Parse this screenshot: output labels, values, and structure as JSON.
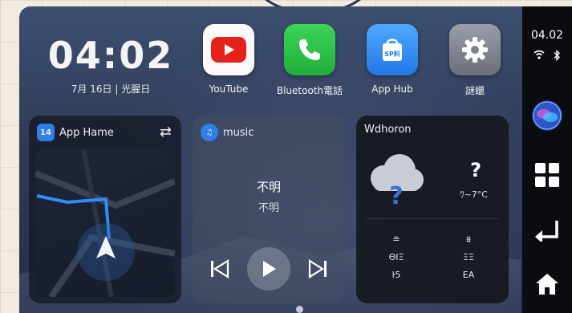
{
  "clock": {
    "time": "04:02",
    "date": "7月 16日 | 光腥日"
  },
  "apps": [
    {
      "label": "YouTube",
      "icon": "youtube-icon"
    },
    {
      "label": "Bluetooth電話",
      "icon": "phone-icon"
    },
    {
      "label": "App Hub",
      "icon": "shopping-bag-icon",
      "icon_text": "SP料"
    },
    {
      "label": "謎蠟",
      "icon": "settings-icon"
    }
  ],
  "nav_card": {
    "title": "App Hame",
    "badge": "14"
  },
  "music_card": {
    "title": "music",
    "track": "不明",
    "artist": "不明"
  },
  "weather_card": {
    "title": "Wdhoron",
    "condition": "?",
    "temp": "ﾜ~7°C",
    "columns": [
      {
        "icon": "≘",
        "line1": "ΘΙΞ",
        "line2": "ŀ5"
      },
      {
        "icon": "⩩",
        "line1": "ΞΞ",
        "line2": "ΕΑ"
      }
    ]
  },
  "rail": {
    "time": "04.02"
  },
  "colors": {
    "accent": "#2f7fe8",
    "screen": "#2e3b57",
    "rail": "#0a0c10"
  }
}
